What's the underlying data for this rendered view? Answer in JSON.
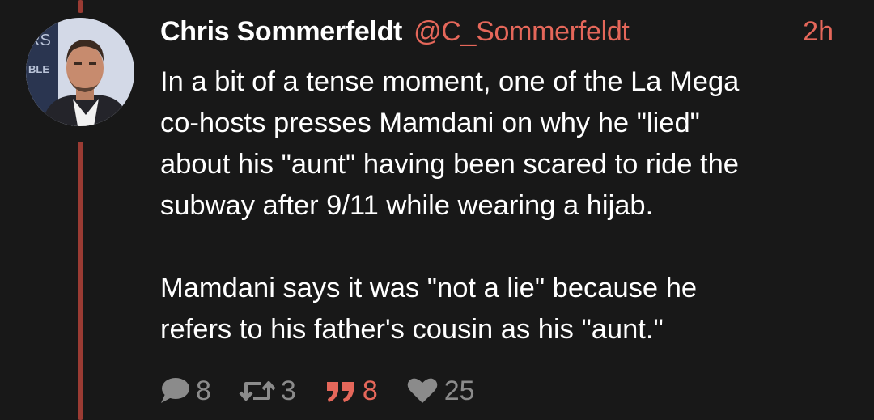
{
  "post": {
    "display_name": "Chris Sommerfeldt",
    "handle": "@C_Sommerfeldt",
    "timestamp": "2h",
    "paragraphs": [
      "In a bit of a tense moment, one of the La Mega\nco-hosts presses Mamdani on why he \"lied\"\nabout his \"aunt\" having been scared to ride the\nsubway after 9/11 while wearing a hijab.",
      "Mamdani says it was \"not a lie\" because he\nrefers to his father's cousin as his \"aunt.\""
    ],
    "avatar_background_text": "RS\nBLE"
  },
  "actions": {
    "replies": "8",
    "reposts": "3",
    "quotes": "8",
    "likes": "25"
  },
  "colors": {
    "background": "#181818",
    "accent": "#e5675a",
    "thread_line": "#9a3b33",
    "muted": "#8b8b8b"
  },
  "icons": {
    "reply": "speech-bubble-icon",
    "repost": "repost-arrows-icon",
    "quote": "quote-marks-icon",
    "like": "heart-icon"
  }
}
